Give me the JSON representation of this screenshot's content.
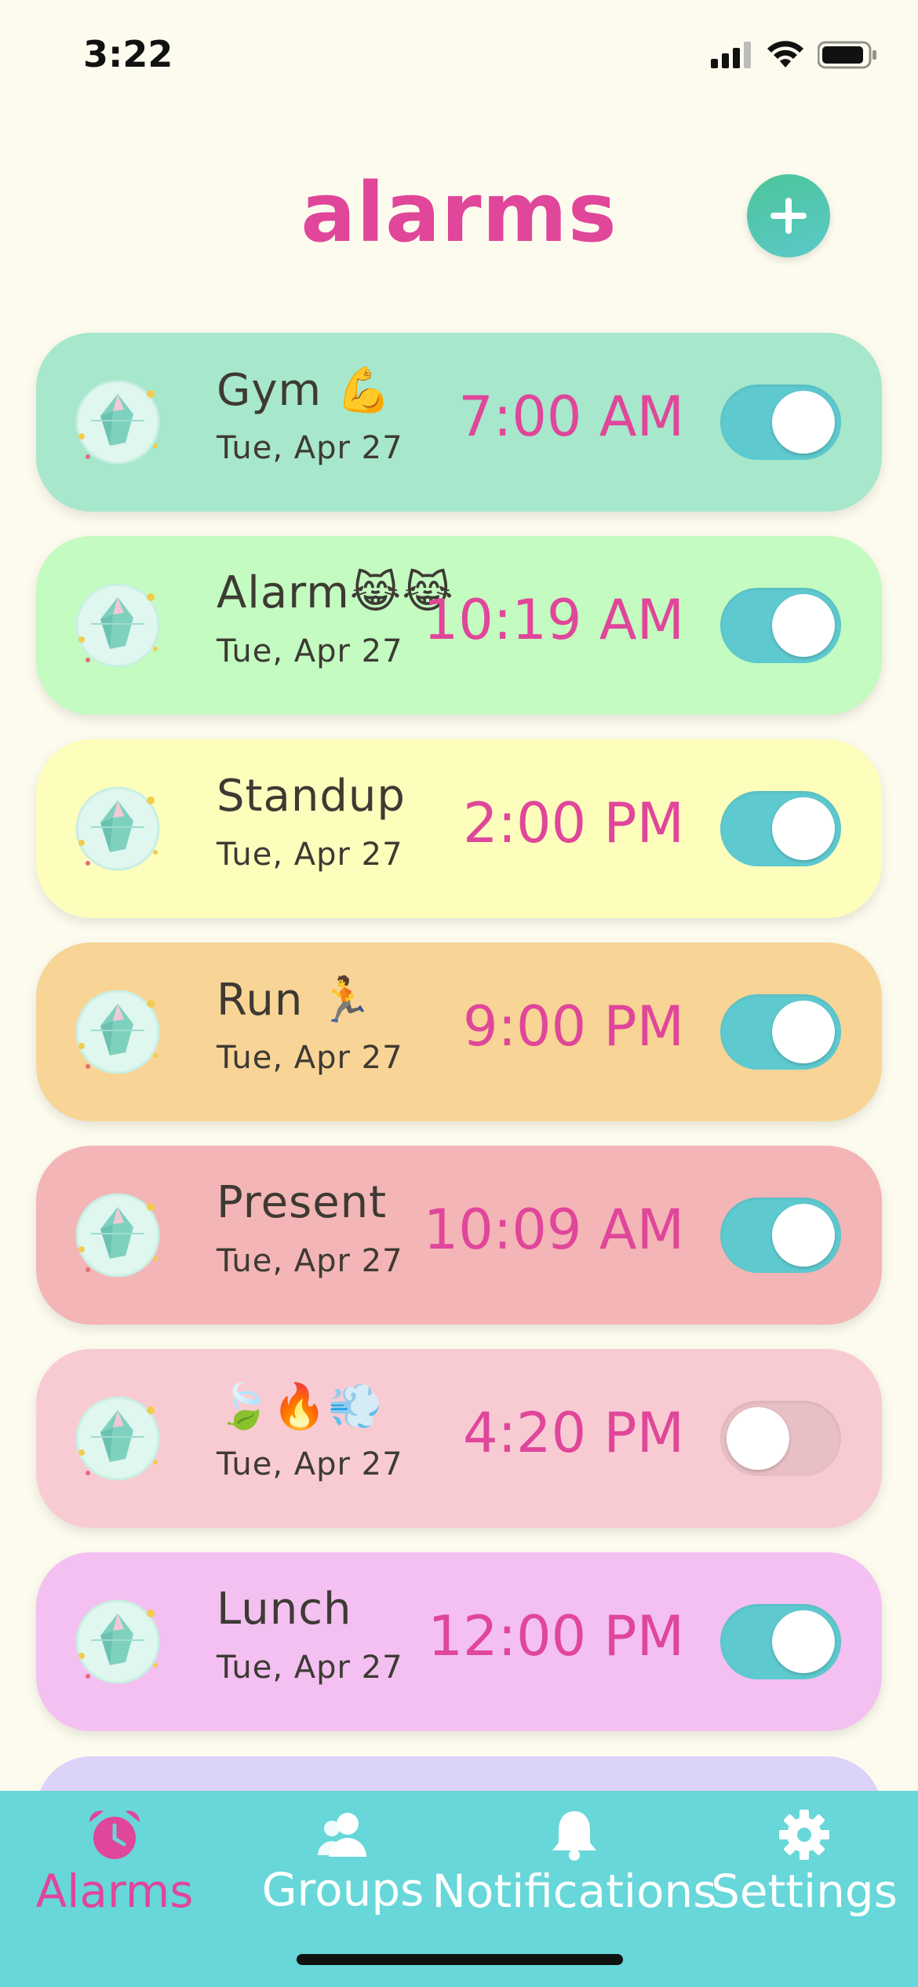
{
  "status_bar": {
    "time": "3:22"
  },
  "header": {
    "title": "alarms"
  },
  "colors": {
    "accent": "#e0469a",
    "toggle_on": "#5ecad0",
    "tabbar": "#67d7d9"
  },
  "alarms": [
    {
      "name": "Gym 💪",
      "date": "Tue, Apr 27",
      "time": "7:00 AM",
      "enabled": true,
      "color": "#a7e7cc"
    },
    {
      "name": "Alarm😹😹",
      "date": "Tue, Apr 27",
      "time": "10:19 AM",
      "enabled": true,
      "color": "#c3fbc0"
    },
    {
      "name": "Standup",
      "date": "Tue, Apr 27",
      "time": "2:00 PM",
      "enabled": true,
      "color": "#fdfdbc"
    },
    {
      "name": "Run 🏃",
      "date": "Tue, Apr 27",
      "time": "9:00 PM",
      "enabled": true,
      "color": "#f8d496"
    },
    {
      "name": "Present",
      "date": "Tue, Apr 27",
      "time": "10:09 AM",
      "enabled": true,
      "color": "#f3b5b5"
    },
    {
      "name": "🍃🔥💨",
      "date": "Tue, Apr 27",
      "time": "4:20 PM",
      "enabled": false,
      "color": "#f8cbd3"
    },
    {
      "name": "Lunch",
      "date": "Tue, Apr 27",
      "time": "12:00 PM",
      "enabled": true,
      "color": "#f3c0f1"
    }
  ],
  "tabs": [
    {
      "label": "Alarms",
      "icon": "alarm-clock-icon",
      "active": true
    },
    {
      "label": "Groups",
      "icon": "groups-icon",
      "active": false
    },
    {
      "label": "Notifications",
      "icon": "bell-icon",
      "active": false
    },
    {
      "label": "Settings",
      "icon": "gear-icon",
      "active": false
    }
  ]
}
